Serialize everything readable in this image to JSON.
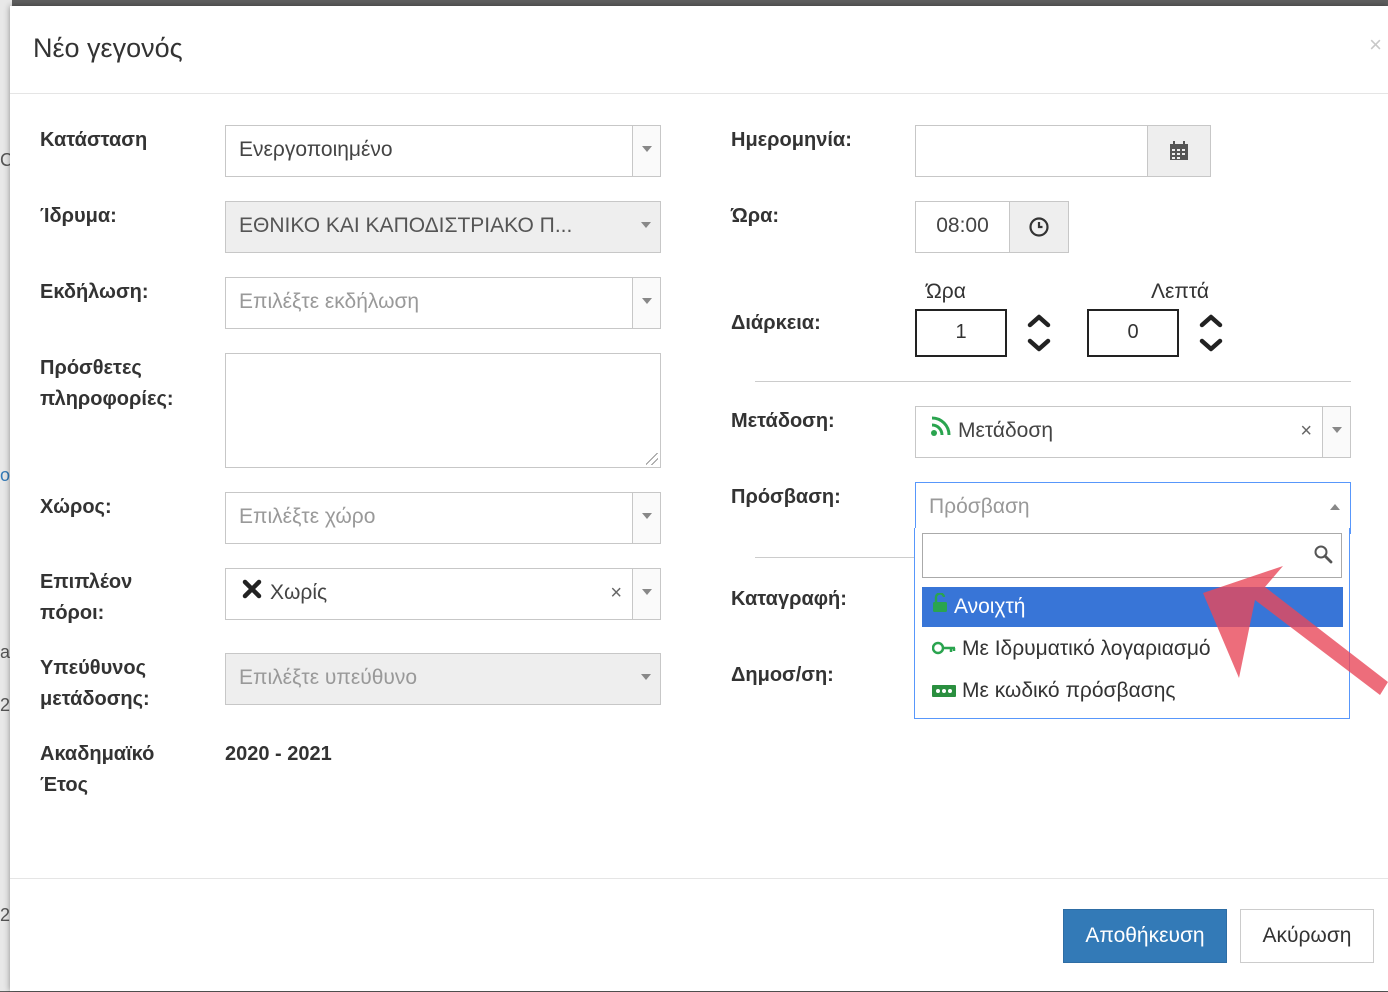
{
  "background": {
    "side_letters": [
      "C",
      "o",
      "a",
      "2",
      "2"
    ]
  },
  "modal": {
    "title": "Νέο γεγονός",
    "close": "×"
  },
  "left": {
    "status": {
      "label": "Κατάσταση",
      "value": "Ενεργοποιημένο"
    },
    "institution": {
      "label": "Ίδρυμα:",
      "value": "ΕΘΝΙΚΟ ΚΑΙ ΚΑΠΟΔΙΣΤΡΙΑΚΟ Π..."
    },
    "event": {
      "label": "Εκδήλωση:",
      "placeholder": "Επιλέξτε εκδήλωση"
    },
    "info": {
      "label_line1": "Πρόσθετες",
      "label_line2": "πληροφορίες:"
    },
    "space": {
      "label": "Χώρος:",
      "placeholder": "Επιλέξτε χώρο"
    },
    "resources": {
      "label_line1": "Επιπλέον",
      "label_line2": "πόροι:",
      "value": "Χωρίς",
      "clear": "×"
    },
    "responsible": {
      "label_line1": "Υπεύθυνος",
      "label_line2": "μετάδοσης:",
      "placeholder": "Επιλέξτε υπεύθυνο"
    },
    "year": {
      "label_line1": "Ακαδημαϊκό",
      "label_line2": "Έτος",
      "value": "2020 - 2021"
    }
  },
  "right": {
    "date": {
      "label": "Ημερομηνία:",
      "value": ""
    },
    "time": {
      "label": "Ώρα:",
      "value": "08:00"
    },
    "duration": {
      "label": "Διάρκεια:",
      "hours_label": "Ώρα",
      "hours_value": "1",
      "minutes_label": "Λεπτά",
      "minutes_value": "0"
    },
    "broadcast": {
      "label": "Μετάδοση:",
      "value": "Μετάδοση",
      "clear": "×"
    },
    "access": {
      "label": "Πρόσβαση:",
      "placeholder": "Πρόσβαση",
      "search_value": "",
      "options": [
        {
          "label": "Ανοιχτή",
          "icon": "unlock-icon",
          "highlighted": true
        },
        {
          "label": "Με Ιδρυματικό λογαριασμό",
          "icon": "key-icon",
          "highlighted": false
        },
        {
          "label": "Με κωδικό πρόσβασης",
          "icon": "password-icon",
          "highlighted": false
        }
      ]
    },
    "recording": {
      "label": "Καταγραφή:"
    },
    "publication": {
      "label": "Δημοσ/ση:"
    }
  },
  "footer": {
    "save": "Αποθήκευση",
    "cancel": "Ακύρωση"
  },
  "colors": {
    "primary": "#337ab7",
    "highlight": "#3875d7",
    "accent_green": "#2aa44f",
    "annotation_arrow": "#e8485a"
  }
}
